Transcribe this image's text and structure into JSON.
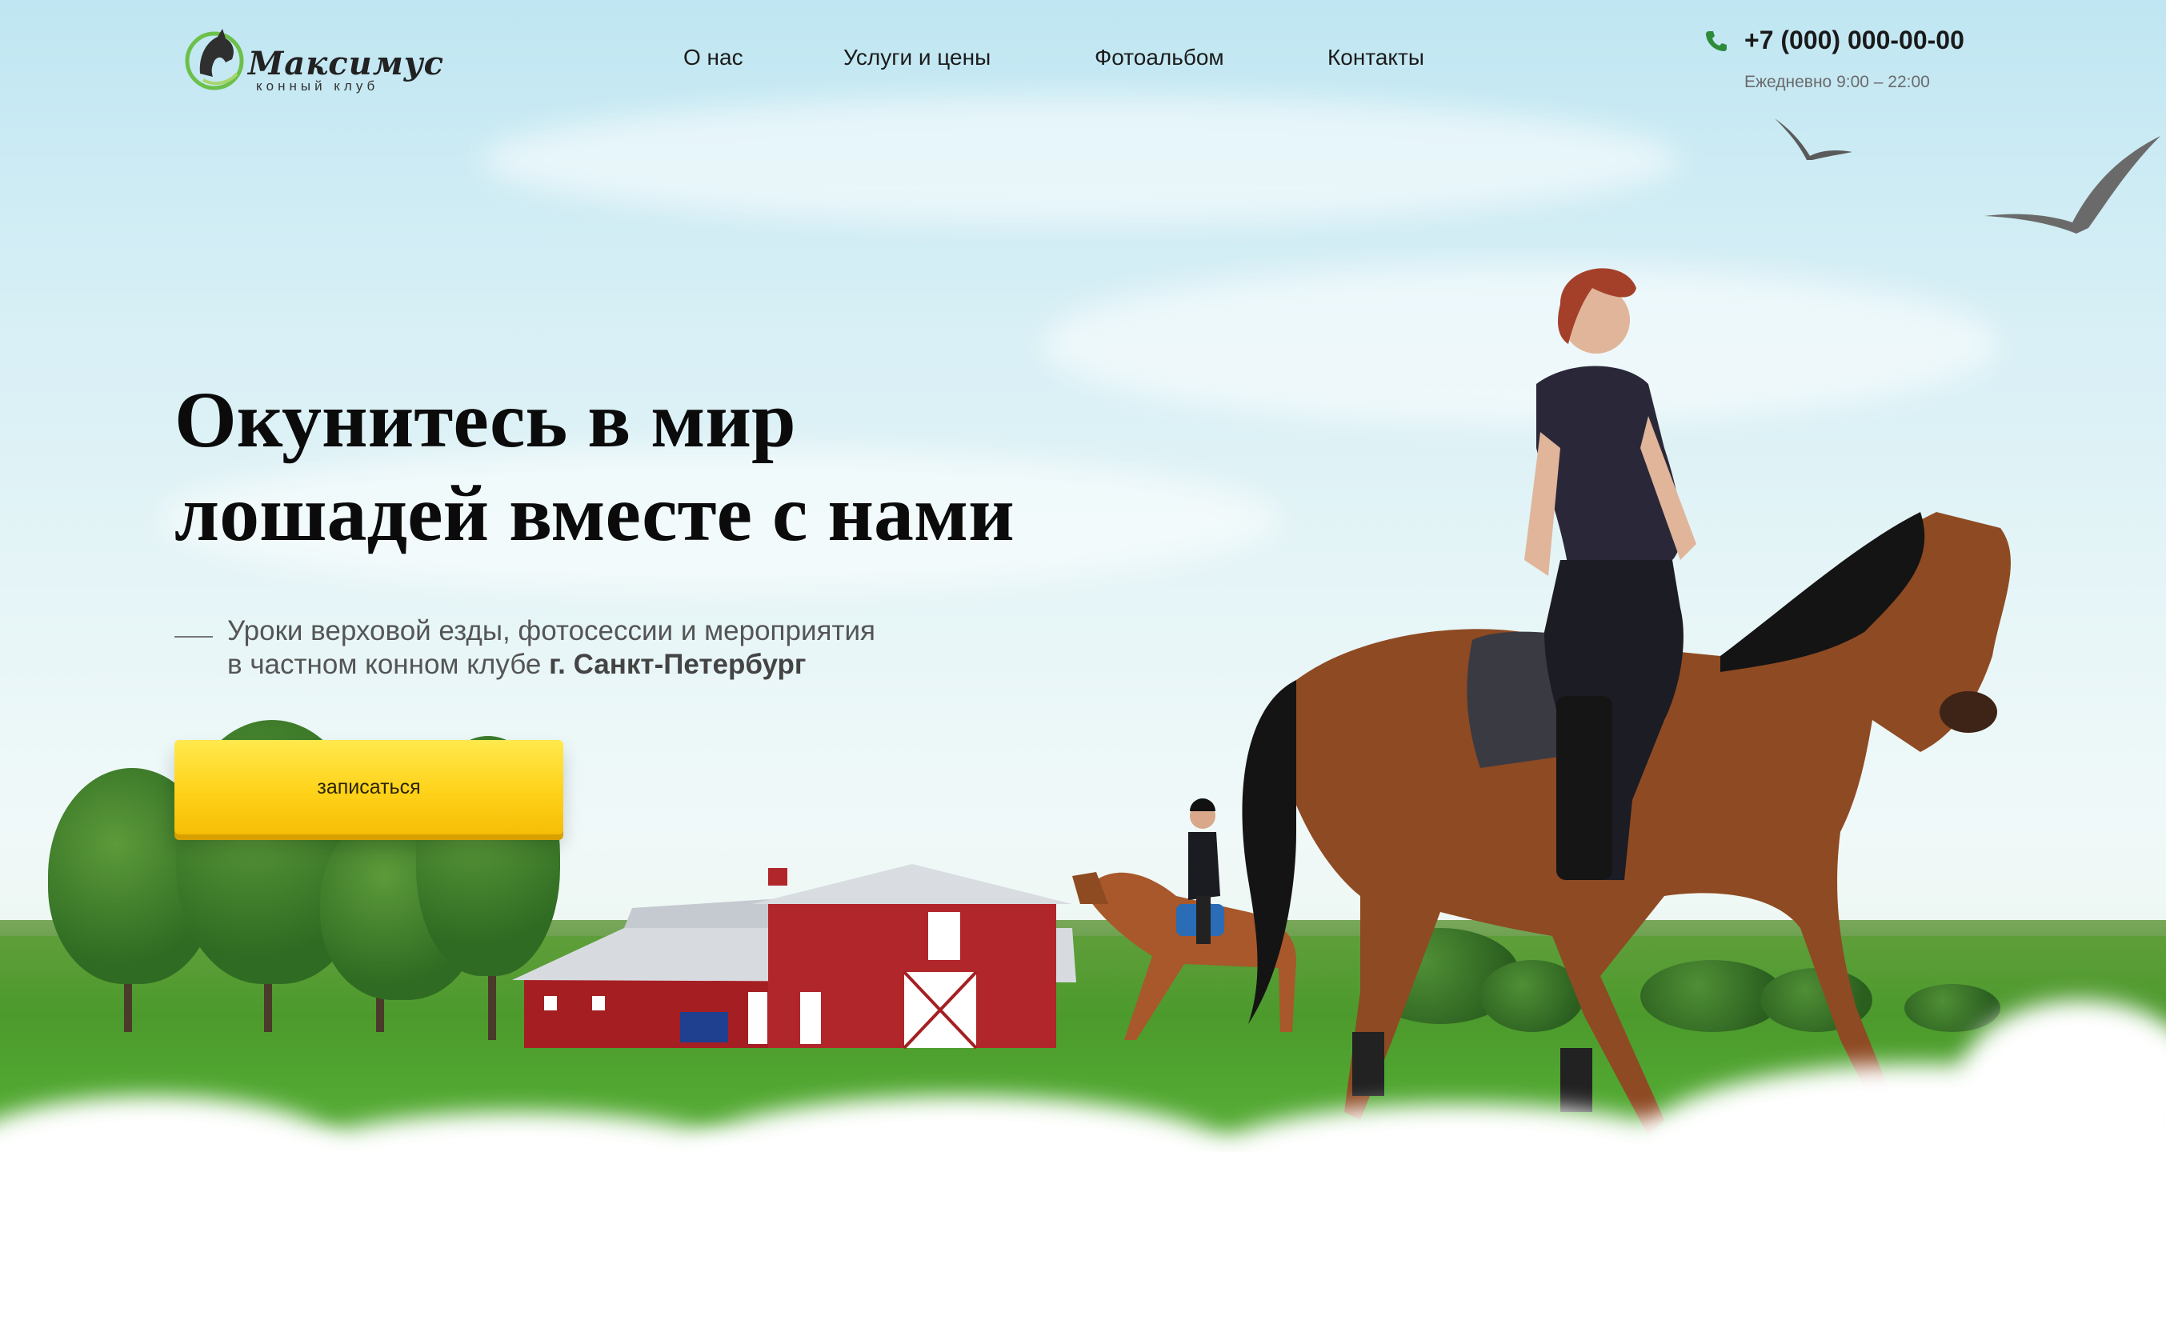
{
  "header": {
    "logo_name": "Максимус",
    "logo_subtitle": "конный клуб",
    "nav": [
      "О нас",
      "Услуги и цены",
      "Фотоальбом",
      "Контакты"
    ],
    "phone": "+7 (000) 000-00-00",
    "hours": "Ежедневно 9:00 – 22:00",
    "icons": {
      "phone": "phone-icon",
      "logo": "horse-head-icon"
    }
  },
  "hero": {
    "headline_line1": "Окунитесь в мир",
    "headline_line2": "лошадей вместе с нами",
    "subtitle_line1": "Уроки верховой езды, фотосессии и мероприятия",
    "subtitle_line2_prefix": "в частном конном клубе ",
    "subtitle_line2_city": "г. Санкт-Петербург",
    "cta_label": "записаться"
  },
  "colors": {
    "accent_yellow": "#ffd21a",
    "logo_green": "#6cc04a",
    "phone_green": "#2e8b3a",
    "text_dark": "#0b0b0b"
  }
}
